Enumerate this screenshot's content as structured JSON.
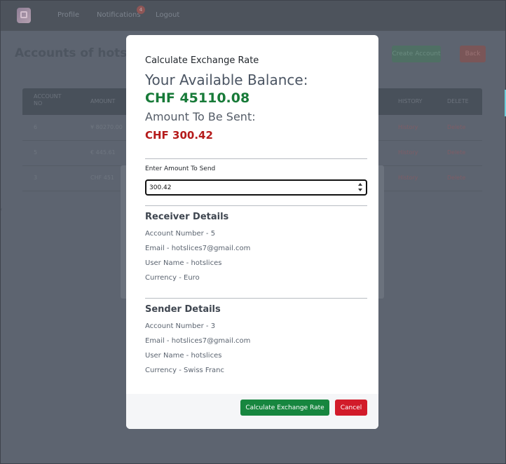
{
  "navbar": {
    "logo_icon": "app-logo-icon",
    "links": [
      "Profile",
      "Notifications",
      "Logout"
    ],
    "notification_count": "4"
  },
  "page": {
    "title": "Accounts of hotslices",
    "create_label": "Create Account",
    "back_label": "Back"
  },
  "table": {
    "headers": [
      "ACCOUNT NO",
      "AMOUNT",
      "HISTORY",
      "DELETE"
    ],
    "rows": [
      {
        "account_no": "6",
        "amount": "¥ 80270.00",
        "history": "History",
        "delete": "Delete"
      },
      {
        "account_no": "5",
        "amount": "€ 445.61",
        "history": "History",
        "delete": "Delete"
      },
      {
        "account_no": "3",
        "amount": "CHF 451",
        "history": "History",
        "delete": "Delete"
      }
    ]
  },
  "modal": {
    "heading": "Calculate Exchange Rate",
    "balance_label": "Your Available Balance:",
    "balance_value": "CHF 45110.08",
    "sent_label": "Amount To Be Sent:",
    "sent_value": "CHF 300.42",
    "input_label": "Enter Amount To Send",
    "input_value": "300.42",
    "receiver": {
      "title": "Receiver Details",
      "account_number": "Account Number - 5",
      "email": "Email - hotslices7@gmail.com",
      "user_name": "User Name - hotslices",
      "currency": "Currency - Euro"
    },
    "sender": {
      "title": "Sender Details",
      "account_number": "Account Number - 3",
      "email": "Email - hotslices7@gmail.com",
      "user_name": "User Name - hotslices",
      "currency": "Currency - Swiss Franc"
    },
    "calculate_label": "Calculate Exchange Rate",
    "cancel_label": "Cancel"
  },
  "colors": {
    "overlay": "#5d6470",
    "balance_green": "#177a38",
    "sent_red": "#b51b1b",
    "calc_button": "#17863f",
    "cancel_button": "#d21b2a"
  }
}
